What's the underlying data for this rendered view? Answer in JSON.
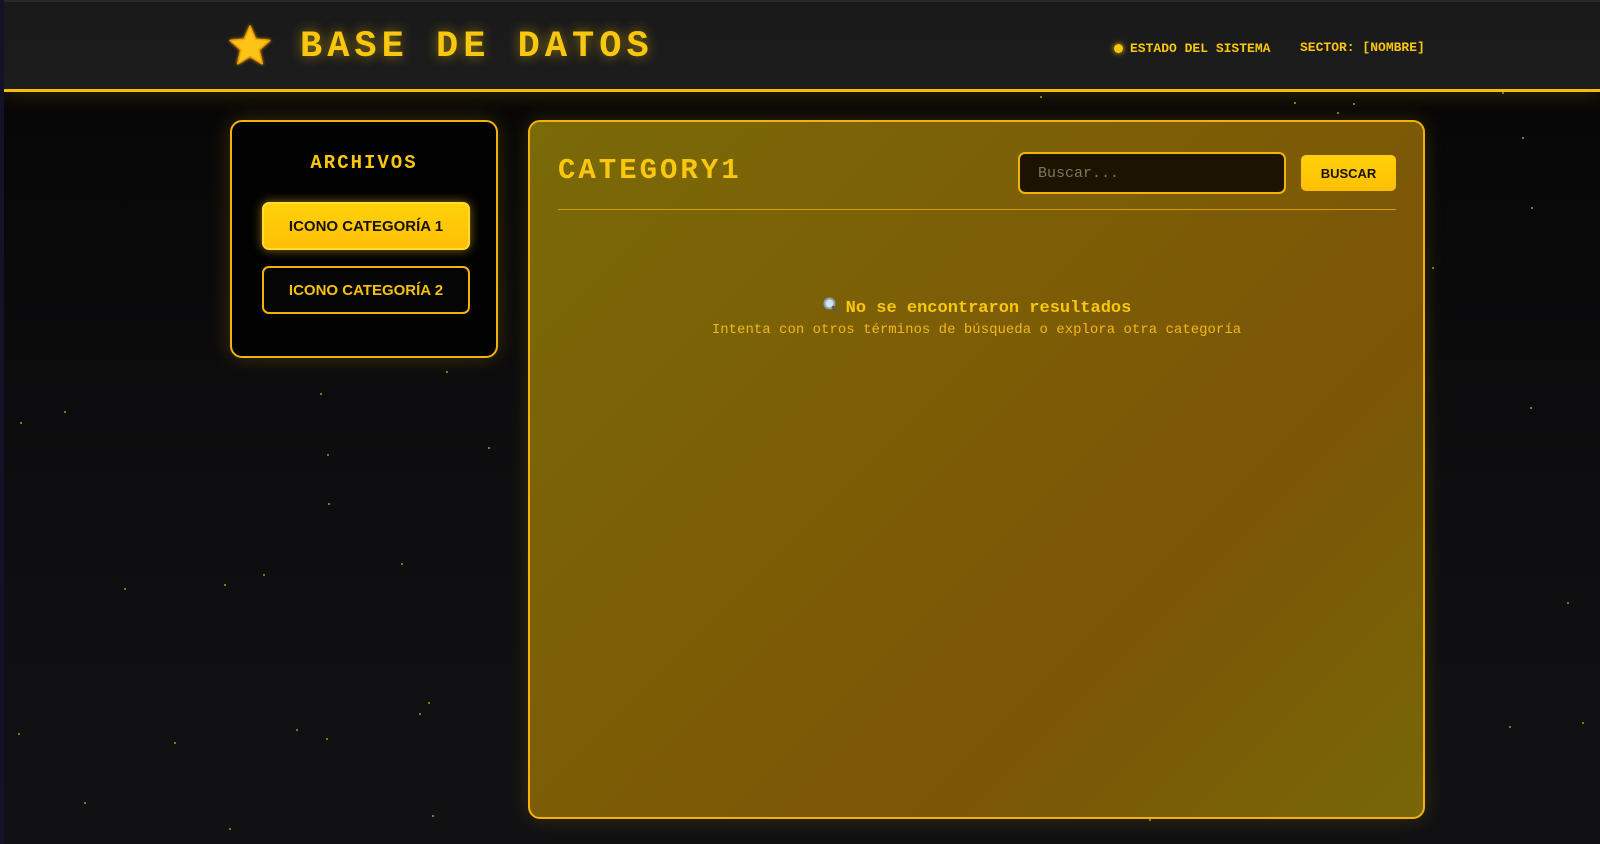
{
  "header": {
    "logo_icon": "star-icon",
    "title": "BASE DE DATOS",
    "status_label": "ESTADO DEL SISTEMA",
    "sector_label": "SECTOR: [NOMBRE]"
  },
  "sidebar": {
    "title": "ARCHIVOS",
    "items": [
      {
        "label": "ICONO CATEGORÍA 1",
        "active": true
      },
      {
        "label": "ICONO CATEGORÍA 2",
        "active": false
      }
    ]
  },
  "main": {
    "title": "CATEGORY1",
    "search": {
      "placeholder": "Buscar...",
      "value": "",
      "button_label": "BUSCAR"
    },
    "empty_state": {
      "icon": "magnifier-icon",
      "title": "No se encontraron resultados",
      "subtitle": "Intenta con otros términos de búsqueda o explora otra categoría"
    }
  },
  "colors": {
    "accent": "#f9c70e",
    "background": "#0b0b0c",
    "panel": "#7b5e07"
  }
}
